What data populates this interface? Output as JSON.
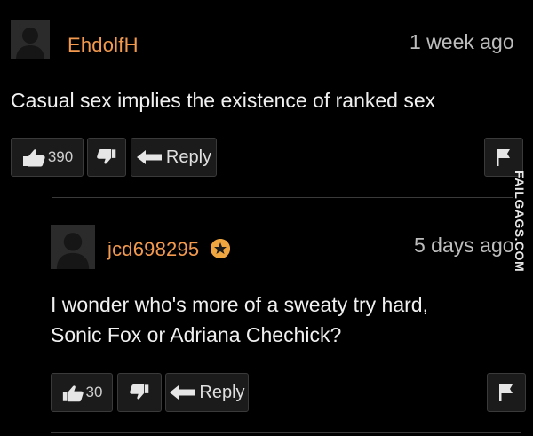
{
  "comments": [
    {
      "username": "EhdolfH",
      "time": "1 week ago",
      "text": "Casual sex implies the existence of ranked sex",
      "likes": "390",
      "reply_label": "Reply"
    },
    {
      "username": "jcd698295",
      "time": "5 days ago",
      "text_line1": "I wonder who's more of a sweaty try hard,",
      "text_line2": "Sonic Fox or Adriana Chechick?",
      "likes": "30",
      "reply_label": "Reply"
    }
  ],
  "watermark": "FAILGAGS.COM",
  "colors": {
    "background": "#000000",
    "username": "#f39a4e",
    "badge": "#f0a640"
  }
}
